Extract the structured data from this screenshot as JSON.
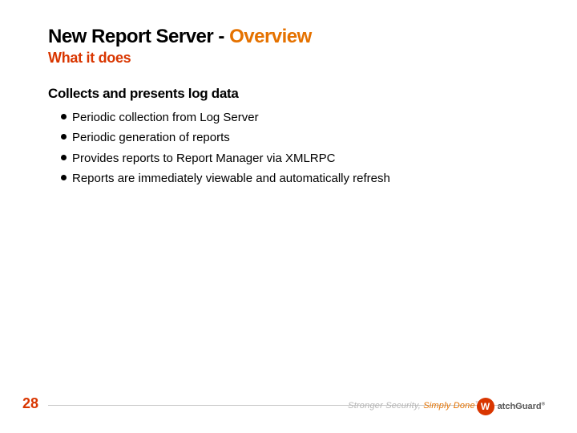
{
  "header": {
    "title_black": "New Report Server - ",
    "title_orange": "Overview",
    "subtitle": "What it does"
  },
  "content": {
    "section_head": "Collects and presents log data",
    "bullets": [
      "Periodic collection from Log Server",
      "Periodic generation of reports",
      "Provides reports to Report Manager via XMLRPC",
      "Reports are immediately viewable and automatically refresh"
    ]
  },
  "footer": {
    "page_number": "28",
    "tagline_prefix": "Stronger Security, ",
    "tagline_orange": "Simply Done",
    "tagline_tm": "™",
    "logo_glyph": "W",
    "logo_name": "atchGuard",
    "logo_reg": "®"
  }
}
